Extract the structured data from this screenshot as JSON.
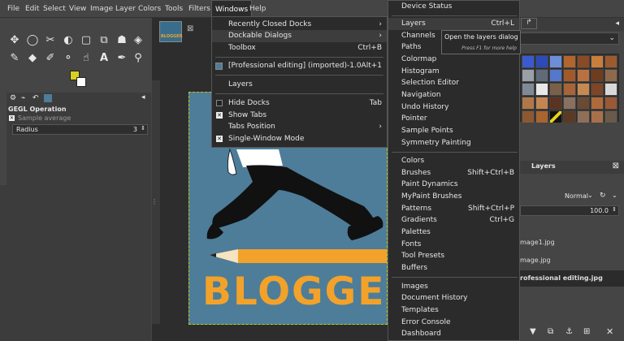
{
  "menubar": {
    "items": [
      "File",
      "Edit",
      "Select",
      "View",
      "Image",
      "Layer",
      "Colors",
      "Tools",
      "Filters",
      "Windows",
      "Help"
    ]
  },
  "tool_options": {
    "title": "GEGL Operation",
    "sample_average": "Sample average",
    "radius_label": "Radius",
    "radius_value": "3"
  },
  "windows_menu": {
    "recently_closed": "Recently Closed Docks",
    "dockable_dialogs": "Dockable Dialogs",
    "toolbox": "Toolbox",
    "toolbox_shortcut": "Ctrl+B",
    "image_entry": "[Professional editing] (imported)-1.0",
    "image_shortcut": "Alt+1",
    "layers": "Layers",
    "hide_docks": "Hide Docks",
    "hide_docks_shortcut": "Tab",
    "show_tabs": "Show Tabs",
    "tabs_position": "Tabs Position",
    "single_window": "Single-Window Mode"
  },
  "dockable_menu": {
    "items": [
      {
        "label": "Device Status",
        "shortcut": ""
      },
      {
        "label": "Layers",
        "shortcut": "Ctrl+L"
      },
      {
        "label": "Channels",
        "shortcut": ""
      },
      {
        "label": "Paths",
        "shortcut": ""
      },
      {
        "label": "Colormap",
        "shortcut": ""
      },
      {
        "label": "Histogram",
        "shortcut": ""
      },
      {
        "label": "Selection Editor",
        "shortcut": ""
      },
      {
        "label": "Navigation",
        "shortcut": ""
      },
      {
        "label": "Undo History",
        "shortcut": ""
      },
      {
        "label": "Pointer",
        "shortcut": ""
      },
      {
        "label": "Sample Points",
        "shortcut": ""
      },
      {
        "label": "Symmetry Painting",
        "shortcut": ""
      },
      {
        "label": "Colors",
        "shortcut": ""
      },
      {
        "label": "Brushes",
        "shortcut": "Shift+Ctrl+B"
      },
      {
        "label": "Paint Dynamics",
        "shortcut": ""
      },
      {
        "label": "MyPaint Brushes",
        "shortcut": ""
      },
      {
        "label": "Patterns",
        "shortcut": "Shift+Ctrl+P"
      },
      {
        "label": "Gradients",
        "shortcut": "Ctrl+G"
      },
      {
        "label": "Palettes",
        "shortcut": ""
      },
      {
        "label": "Fonts",
        "shortcut": ""
      },
      {
        "label": "Tool Presets",
        "shortcut": ""
      },
      {
        "label": "Buffers",
        "shortcut": ""
      },
      {
        "label": "Images",
        "shortcut": ""
      },
      {
        "label": "Document History",
        "shortcut": ""
      },
      {
        "label": "Templates",
        "shortcut": ""
      },
      {
        "label": "Error Console",
        "shortcut": ""
      },
      {
        "label": "Dashboard",
        "shortcut": ""
      }
    ]
  },
  "tooltip": {
    "text": "Open the layers dialog",
    "hint": "Press F1 for more help"
  },
  "layers_panel": {
    "title": "Layers",
    "mode": "Normal",
    "opacity": "100.0",
    "layers": [
      "mage1.jpg",
      "mage.jpg",
      "rofessional editing.jpg"
    ]
  },
  "canvas": {
    "thumb_text": "BLOGGER",
    "image_text": "BLOGGE"
  },
  "colors": {
    "fg": "#d8d020",
    "bg": "#ffffff",
    "accent": "#f2a22a",
    "canvas_bg": "#4d7d99"
  }
}
